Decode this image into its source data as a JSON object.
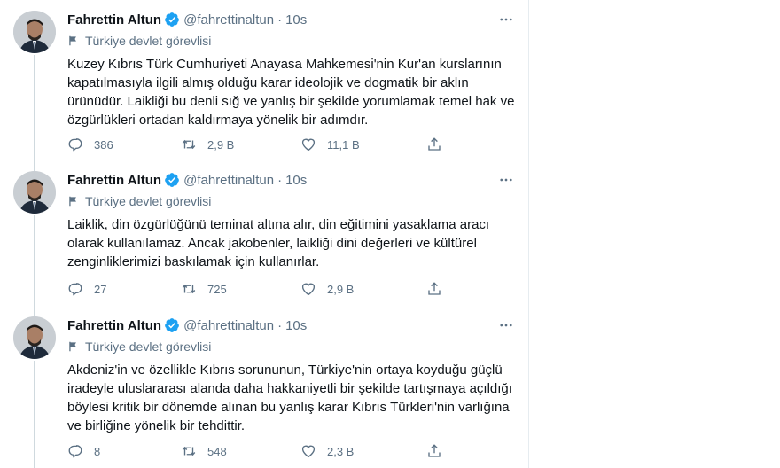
{
  "tweets": [
    {
      "name": "Fahrettin Altun",
      "handle": "@fahrettinaltun",
      "dot": "·",
      "time": "10s",
      "label": "Türkiye devlet görevlisi",
      "lines": [
        "Kuzey Kıbrıs Türk Cumhuriyeti Anayasa Mahkemesi'nin Kur'an kurslarının",
        "kapatılmasıyla ilgili almış olduğu karar ideolojik ve dogmatik bir aklın",
        "ürünüdür. Laikliği bu denli sığ ve yanlış bir şekilde yorumlamak temel hak ve",
        "özgürlükleri ortadan kaldırmaya yönelik bir adımdır."
      ],
      "replies": "386",
      "retweets": "2,9 B",
      "likes": "11,1 B"
    },
    {
      "name": "Fahrettin Altun",
      "handle": "@fahrettinaltun",
      "dot": "·",
      "time": "10s",
      "label": "Türkiye devlet görevlisi",
      "lines": [
        "Laiklik, din özgürlüğünü teminat altına alır, din eğitimini yasaklama aracı",
        "olarak kullanılamaz. Ancak jakobenler, laikliği dini değerleri ve kültürel",
        "zenginliklerimizi baskılamak için kullanırlar."
      ],
      "replies": "27",
      "retweets": "725",
      "likes": "2,9 B"
    },
    {
      "name": "Fahrettin Altun",
      "handle": "@fahrettinaltun",
      "dot": "·",
      "time": "10s",
      "label": "Türkiye devlet görevlisi",
      "lines": [
        "Akdeniz'in ve özellikle Kıbrıs sorununun, Türkiye'nin ortaya koyduğu güçlü",
        "iradeyle uluslararası alanda daha hakkaniyetli bir şekilde tartışmaya açıldığı",
        "böylesi kritik bir dönemde alınan bu yanlış karar Kıbrıs Türkleri'nin varlığına",
        "ve birliğine yönelik bir tehdittir."
      ],
      "replies": "8",
      "retweets": "548",
      "likes": "2,3 B"
    }
  ],
  "icons": {
    "verified": "verified-badge-icon",
    "flag": "flag-icon",
    "more": "more-dots-icon",
    "reply": "reply-bubble-icon",
    "retweet": "retweet-icon",
    "like": "heart-icon",
    "share": "share-icon"
  },
  "colors": {
    "text": "#0f1419",
    "secondary": "#5b7083",
    "verified": "#1da1f2",
    "thread": "#cfd9de"
  }
}
